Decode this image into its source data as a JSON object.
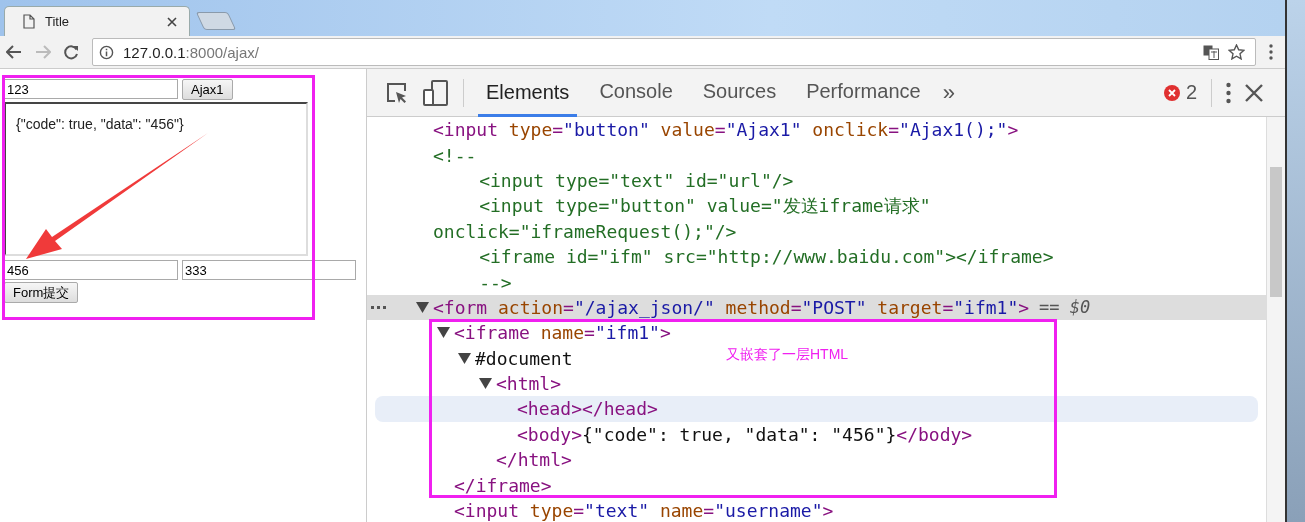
{
  "browser": {
    "tab_title": "Title",
    "url_host": "127.0.0.1",
    "url_path": ":8000/ajax/"
  },
  "page": {
    "text_input": {
      "value": "123"
    },
    "ajax_button": "Ajax1",
    "iframe_text": "{\"code\": true, \"data\": \"456\"}",
    "form_inputs": [
      {
        "value": "456"
      },
      {
        "value": "333"
      }
    ],
    "submit_button": "Form提交"
  },
  "devtools": {
    "tabs": [
      {
        "label": "Elements",
        "selected": true
      },
      {
        "label": "Console",
        "selected": false
      },
      {
        "label": "Sources",
        "selected": false
      },
      {
        "label": "Performance",
        "selected": false
      }
    ],
    "overflow": "»",
    "error_count": "2",
    "tree": [
      {
        "parts": [
          {
            "kind": "tag",
            "text": "<input"
          },
          {
            "kind": "attr",
            "text": " type"
          },
          {
            "kind": "tag",
            "text": "="
          },
          {
            "kind": "value",
            "text": "\"button\""
          },
          {
            "kind": "attr",
            "text": " value"
          },
          {
            "kind": "tag",
            "text": "="
          },
          {
            "kind": "value",
            "text": "\"Ajax1\""
          },
          {
            "kind": "attr",
            "text": " onclick"
          },
          {
            "kind": "tag",
            "text": "="
          },
          {
            "kind": "value",
            "text": "\"Ajax1();\""
          },
          {
            "kind": "tag",
            "text": ">"
          }
        ],
        "selected": false,
        "hovered": false
      },
      {
        "parts": [
          {
            "kind": "comment",
            "text": "<!--"
          }
        ],
        "selected": false,
        "hovered": false,
        "comment_children": [
          {
            "parts": [
              {
                "kind": "comment",
                "text": "<input type=\"text\" id=\"url\"/>"
              }
            ]
          },
          {
            "parts": [
              {
                "kind": "comment",
                "text": "<input type=\"button\" value=\"发送iframe请求\""
              }
            ],
            "continuation": [
              {
                "kind": "comment",
                "text": "onclick=\"iframeRequest();\"/>"
              }
            ]
          },
          {
            "parts": [
              {
                "kind": "comment",
                "text": "<iframe id=\"ifm\" src=\"http://www.baidu.com\"></iframe>"
              }
            ]
          },
          {
            "parts": [
              {
                "kind": "comment",
                "text": "-->"
              }
            ]
          }
        ]
      },
      {
        "parts": [
          {
            "kind": "tag",
            "text": "<form"
          },
          {
            "kind": "attr",
            "text": " action"
          },
          {
            "kind": "tag",
            "text": "="
          },
          {
            "kind": "value",
            "text": "\"/ajax_json/\""
          },
          {
            "kind": "attr",
            "text": " method"
          },
          {
            "kind": "tag",
            "text": "="
          },
          {
            "kind": "value",
            "text": "\"POST\""
          },
          {
            "kind": "attr",
            "text": " target"
          },
          {
            "kind": "tag",
            "text": "="
          },
          {
            "kind": "value",
            "text": "\"ifm1\""
          },
          {
            "kind": "tag",
            "text": ">"
          }
        ],
        "selected": true,
        "hovered": false,
        "marker": "== $0",
        "expanded": true,
        "children": [
          {
            "parts": [
              {
                "kind": "tag",
                "text": "<iframe"
              },
              {
                "kind": "attr",
                "text": " name"
              },
              {
                "kind": "tag",
                "text": "="
              },
              {
                "kind": "value",
                "text": "\"ifm1\""
              },
              {
                "kind": "tag",
                "text": ">"
              }
            ],
            "selected": false,
            "hovered": false,
            "expanded": true,
            "close": [
              {
                "kind": "tag",
                "text": "</iframe>"
              }
            ],
            "children": [
              {
                "parts": [
                  {
                    "kind": "text",
                    "text": "#document"
                  }
                ],
                "selected": false,
                "hovered": false,
                "expanded": true,
                "children": [
                  {
                    "parts": [
                      {
                        "kind": "tag",
                        "text": "<html>"
                      }
                    ],
                    "selected": false,
                    "hovered": false,
                    "expanded": true,
                    "close": [
                      {
                        "kind": "tag",
                        "text": "</html>"
                      }
                    ],
                    "children": [
                      {
                        "parts": [
                          {
                            "kind": "tag",
                            "text": "<head></head>"
                          }
                        ],
                        "selected": false,
                        "hovered": true
                      },
                      {
                        "parts": [
                          {
                            "kind": "tag",
                            "text": "<body>"
                          },
                          {
                            "kind": "text",
                            "text": "{\"code\": true, \"data\": \"456\"}"
                          },
                          {
                            "kind": "tag",
                            "text": "</body>"
                          }
                        ],
                        "selected": false,
                        "hovered": false
                      }
                    ]
                  }
                ]
              }
            ]
          },
          {
            "parts": [
              {
                "kind": "tag",
                "text": "<input"
              },
              {
                "kind": "attr",
                "text": " type"
              },
              {
                "kind": "tag",
                "text": "="
              },
              {
                "kind": "value",
                "text": "\"text\""
              },
              {
                "kind": "attr",
                "text": " name"
              },
              {
                "kind": "tag",
                "text": "="
              },
              {
                "kind": "value",
                "text": "\"username\""
              },
              {
                "kind": "tag",
                "text": ">"
              }
            ],
            "selected": false,
            "hovered": false
          }
        ]
      }
    ]
  },
  "annotation": "又嵌套了一层HTML"
}
